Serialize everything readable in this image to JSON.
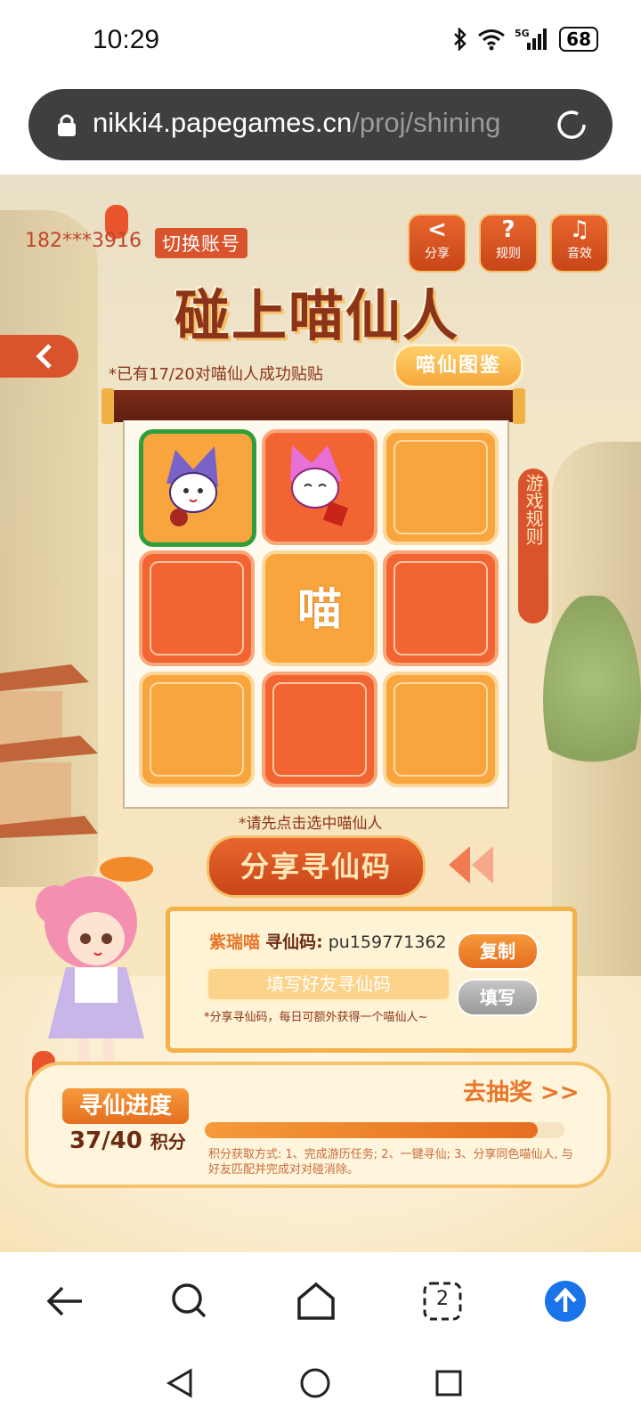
{
  "status_bar": {
    "time": "10:29",
    "battery": "68",
    "network": "5G"
  },
  "browser": {
    "url_domain": "nikki4.papegames.cn",
    "url_path": "/proj/shining"
  },
  "game": {
    "account": "182***3916",
    "switch_account": "切换账号",
    "top_buttons": [
      {
        "label": "分享",
        "icon": "share-icon"
      },
      {
        "label": "规则",
        "icon": "question-icon"
      },
      {
        "label": "音效",
        "icon": "music-icon"
      }
    ],
    "title": "碰上喵仙人",
    "progress_note": "*已有17/20对喵仙人成功贴贴",
    "guide_button": "喵仙图鉴",
    "side_rules": "游戏规则",
    "grid": {
      "cells": [
        "cat-purple-selected",
        "cat-pink",
        "orange",
        "red",
        "meow",
        "red",
        "orange",
        "red",
        "orange"
      ],
      "meow_label": "喵"
    },
    "hint": "*请先点击选中喵仙人",
    "share_button": "分享寻仙码",
    "code_panel": {
      "cat_name": "紫瑞喵",
      "code_label": "寻仙码:",
      "code_value": "pu159771362",
      "copy_button": "复制",
      "input_placeholder": "填写好友寻仙码",
      "fill_button": "填写",
      "note": "*分享寻仙码，每日可额外获得一个喵仙人~"
    },
    "progress_panel": {
      "label": "寻仙进度",
      "score": "37/40",
      "unit": "积分",
      "score_fraction": 0.925,
      "lottery": "去抽奖 >>",
      "rules": "积分获取方式: 1、完成游历任务; 2、一键寻仙; 3、分享同色喵仙人, 与好友匹配并完成对对碰消除。"
    }
  },
  "browser_nav": {
    "items": [
      "back-icon",
      "search-icon",
      "home-icon",
      "tabs-icon",
      "upload-icon"
    ],
    "tab_count": "2"
  },
  "colors": {
    "accent": "#d9542c",
    "orange": "#f7a53c",
    "red": "#f26432",
    "selected": "#2f9e3a"
  }
}
